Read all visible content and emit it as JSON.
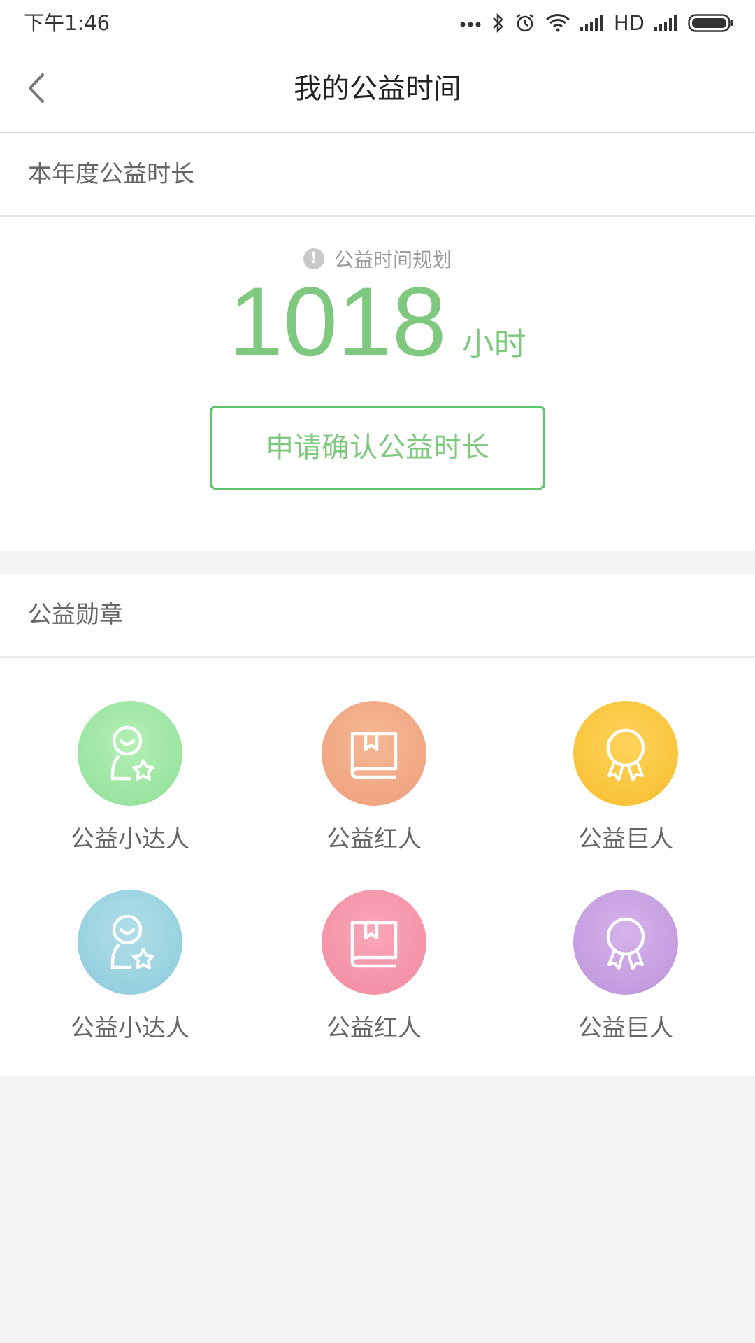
{
  "status_bar": {
    "time": "下午1:46",
    "network": "HD"
  },
  "header": {
    "title": "我的公益时间",
    "back_icon": "chevron-left-icon"
  },
  "annual_hours": {
    "section_title": "本年度公益时长",
    "plan_link": "公益时间规划",
    "hours": "1018",
    "unit": "小时",
    "apply_button": "申请确认公益时长",
    "accent_color": "#7fc87f",
    "border_color": "#5ec46c"
  },
  "medals": {
    "section_title": "公益勋章",
    "items": [
      {
        "label": "公益小达人",
        "icon": "person-star-icon",
        "color": "#9fe6a6"
      },
      {
        "label": "公益红人",
        "icon": "book-icon",
        "color": "#f2a883"
      },
      {
        "label": "公益巨人",
        "icon": "award-ribbon-icon",
        "color": "#f7c53a"
      },
      {
        "label": "公益小达人",
        "icon": "person-star-icon",
        "color": "#9dd4e2"
      },
      {
        "label": "公益红人",
        "icon": "book-icon",
        "color": "#f596aa"
      },
      {
        "label": "公益巨人",
        "icon": "award-ribbon-icon",
        "color": "#c9a3e1"
      }
    ]
  }
}
